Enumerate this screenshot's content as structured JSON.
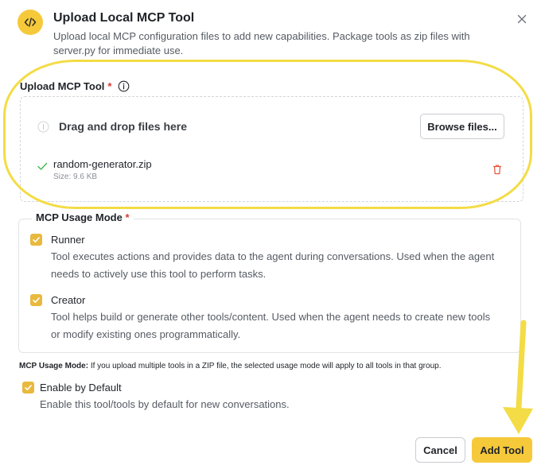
{
  "dialog": {
    "title": "Upload Local MCP Tool",
    "subtitle": "Upload local MCP configuration files to add new capabilities. Package tools as zip files with server.py for immediate use.",
    "icon": "code-icon"
  },
  "upload": {
    "label": "Upload MCP Tool",
    "required_mark": "*",
    "dropzone_text": "Drag and drop files here",
    "browse_label": "Browse files...",
    "file": {
      "name": "random-generator.zip",
      "size": "Size: 9.6 KB",
      "status": "uploaded"
    }
  },
  "usage_mode": {
    "legend": "MCP Usage Mode",
    "required_mark": "*",
    "options": [
      {
        "title": "Runner",
        "checked": true,
        "description": "Tool executes actions and provides data to the agent during conversations. Used when the agent needs to actively use this tool to perform tasks."
      },
      {
        "title": "Creator",
        "checked": true,
        "description": "Tool helps build or generate other tools/content. Used when the agent needs to create new tools or modify existing ones programmatically."
      }
    ],
    "note_label": "MCP Usage Mode:",
    "note_text": " If you upload multiple tools in a ZIP file, the selected usage mode will apply to all tools in that group."
  },
  "enable_default": {
    "title": "Enable by Default",
    "checked": true,
    "description": "Enable this tool/tools by default for new conversations."
  },
  "footer": {
    "cancel_label": "Cancel",
    "add_label": "Add Tool"
  },
  "colors": {
    "accent": "#f6c93a",
    "checkbox": "#e9b93e",
    "required": "#d73a31",
    "success": "#3fb950",
    "danger": "#e5533d",
    "annotation": "#f3dc45"
  }
}
